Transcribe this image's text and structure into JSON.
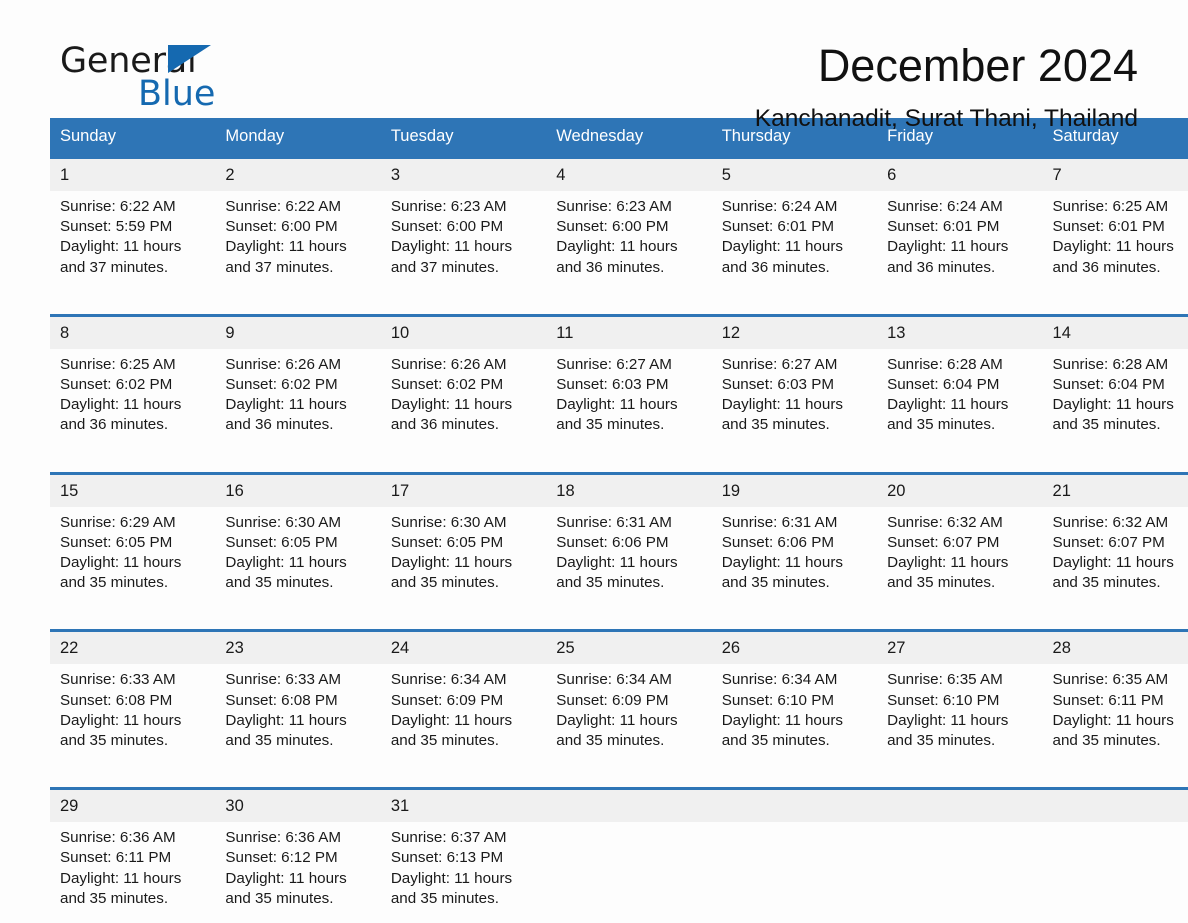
{
  "brand": {
    "name_line1": "General",
    "name_line2": "Blue",
    "accent_color": "#2e75b6",
    "logo_blue": "#1569b0"
  },
  "header": {
    "title": "December 2024",
    "subtitle": "Kanchanadit, Surat Thani, Thailand"
  },
  "calendar": {
    "weekday_headers": [
      "Sunday",
      "Monday",
      "Tuesday",
      "Wednesday",
      "Thursday",
      "Friday",
      "Saturday"
    ],
    "weeks": [
      [
        {
          "day": "1",
          "sunrise": "Sunrise: 6:22 AM",
          "sunset": "Sunset: 5:59 PM",
          "daylight1": "Daylight: 11 hours",
          "daylight2": "and 37 minutes."
        },
        {
          "day": "2",
          "sunrise": "Sunrise: 6:22 AM",
          "sunset": "Sunset: 6:00 PM",
          "daylight1": "Daylight: 11 hours",
          "daylight2": "and 37 minutes."
        },
        {
          "day": "3",
          "sunrise": "Sunrise: 6:23 AM",
          "sunset": "Sunset: 6:00 PM",
          "daylight1": "Daylight: 11 hours",
          "daylight2": "and 37 minutes."
        },
        {
          "day": "4",
          "sunrise": "Sunrise: 6:23 AM",
          "sunset": "Sunset: 6:00 PM",
          "daylight1": "Daylight: 11 hours",
          "daylight2": "and 36 minutes."
        },
        {
          "day": "5",
          "sunrise": "Sunrise: 6:24 AM",
          "sunset": "Sunset: 6:01 PM",
          "daylight1": "Daylight: 11 hours",
          "daylight2": "and 36 minutes."
        },
        {
          "day": "6",
          "sunrise": "Sunrise: 6:24 AM",
          "sunset": "Sunset: 6:01 PM",
          "daylight1": "Daylight: 11 hours",
          "daylight2": "and 36 minutes."
        },
        {
          "day": "7",
          "sunrise": "Sunrise: 6:25 AM",
          "sunset": "Sunset: 6:01 PM",
          "daylight1": "Daylight: 11 hours",
          "daylight2": "and 36 minutes."
        }
      ],
      [
        {
          "day": "8",
          "sunrise": "Sunrise: 6:25 AM",
          "sunset": "Sunset: 6:02 PM",
          "daylight1": "Daylight: 11 hours",
          "daylight2": "and 36 minutes."
        },
        {
          "day": "9",
          "sunrise": "Sunrise: 6:26 AM",
          "sunset": "Sunset: 6:02 PM",
          "daylight1": "Daylight: 11 hours",
          "daylight2": "and 36 minutes."
        },
        {
          "day": "10",
          "sunrise": "Sunrise: 6:26 AM",
          "sunset": "Sunset: 6:02 PM",
          "daylight1": "Daylight: 11 hours",
          "daylight2": "and 36 minutes."
        },
        {
          "day": "11",
          "sunrise": "Sunrise: 6:27 AM",
          "sunset": "Sunset: 6:03 PM",
          "daylight1": "Daylight: 11 hours",
          "daylight2": "and 35 minutes."
        },
        {
          "day": "12",
          "sunrise": "Sunrise: 6:27 AM",
          "sunset": "Sunset: 6:03 PM",
          "daylight1": "Daylight: 11 hours",
          "daylight2": "and 35 minutes."
        },
        {
          "day": "13",
          "sunrise": "Sunrise: 6:28 AM",
          "sunset": "Sunset: 6:04 PM",
          "daylight1": "Daylight: 11 hours",
          "daylight2": "and 35 minutes."
        },
        {
          "day": "14",
          "sunrise": "Sunrise: 6:28 AM",
          "sunset": "Sunset: 6:04 PM",
          "daylight1": "Daylight: 11 hours",
          "daylight2": "and 35 minutes."
        }
      ],
      [
        {
          "day": "15",
          "sunrise": "Sunrise: 6:29 AM",
          "sunset": "Sunset: 6:05 PM",
          "daylight1": "Daylight: 11 hours",
          "daylight2": "and 35 minutes."
        },
        {
          "day": "16",
          "sunrise": "Sunrise: 6:30 AM",
          "sunset": "Sunset: 6:05 PM",
          "daylight1": "Daylight: 11 hours",
          "daylight2": "and 35 minutes."
        },
        {
          "day": "17",
          "sunrise": "Sunrise: 6:30 AM",
          "sunset": "Sunset: 6:05 PM",
          "daylight1": "Daylight: 11 hours",
          "daylight2": "and 35 minutes."
        },
        {
          "day": "18",
          "sunrise": "Sunrise: 6:31 AM",
          "sunset": "Sunset: 6:06 PM",
          "daylight1": "Daylight: 11 hours",
          "daylight2": "and 35 minutes."
        },
        {
          "day": "19",
          "sunrise": "Sunrise: 6:31 AM",
          "sunset": "Sunset: 6:06 PM",
          "daylight1": "Daylight: 11 hours",
          "daylight2": "and 35 minutes."
        },
        {
          "day": "20",
          "sunrise": "Sunrise: 6:32 AM",
          "sunset": "Sunset: 6:07 PM",
          "daylight1": "Daylight: 11 hours",
          "daylight2": "and 35 minutes."
        },
        {
          "day": "21",
          "sunrise": "Sunrise: 6:32 AM",
          "sunset": "Sunset: 6:07 PM",
          "daylight1": "Daylight: 11 hours",
          "daylight2": "and 35 minutes."
        }
      ],
      [
        {
          "day": "22",
          "sunrise": "Sunrise: 6:33 AM",
          "sunset": "Sunset: 6:08 PM",
          "daylight1": "Daylight: 11 hours",
          "daylight2": "and 35 minutes."
        },
        {
          "day": "23",
          "sunrise": "Sunrise: 6:33 AM",
          "sunset": "Sunset: 6:08 PM",
          "daylight1": "Daylight: 11 hours",
          "daylight2": "and 35 minutes."
        },
        {
          "day": "24",
          "sunrise": "Sunrise: 6:34 AM",
          "sunset": "Sunset: 6:09 PM",
          "daylight1": "Daylight: 11 hours",
          "daylight2": "and 35 minutes."
        },
        {
          "day": "25",
          "sunrise": "Sunrise: 6:34 AM",
          "sunset": "Sunset: 6:09 PM",
          "daylight1": "Daylight: 11 hours",
          "daylight2": "and 35 minutes."
        },
        {
          "day": "26",
          "sunrise": "Sunrise: 6:34 AM",
          "sunset": "Sunset: 6:10 PM",
          "daylight1": "Daylight: 11 hours",
          "daylight2": "and 35 minutes."
        },
        {
          "day": "27",
          "sunrise": "Sunrise: 6:35 AM",
          "sunset": "Sunset: 6:10 PM",
          "daylight1": "Daylight: 11 hours",
          "daylight2": "and 35 minutes."
        },
        {
          "day": "28",
          "sunrise": "Sunrise: 6:35 AM",
          "sunset": "Sunset: 6:11 PM",
          "daylight1": "Daylight: 11 hours",
          "daylight2": "and 35 minutes."
        }
      ],
      [
        {
          "day": "29",
          "sunrise": "Sunrise: 6:36 AM",
          "sunset": "Sunset: 6:11 PM",
          "daylight1": "Daylight: 11 hours",
          "daylight2": "and 35 minutes."
        },
        {
          "day": "30",
          "sunrise": "Sunrise: 6:36 AM",
          "sunset": "Sunset: 6:12 PM",
          "daylight1": "Daylight: 11 hours",
          "daylight2": "and 35 minutes."
        },
        {
          "day": "31",
          "sunrise": "Sunrise: 6:37 AM",
          "sunset": "Sunset: 6:13 PM",
          "daylight1": "Daylight: 11 hours",
          "daylight2": "and 35 minutes."
        },
        {
          "day": "",
          "sunrise": "",
          "sunset": "",
          "daylight1": "",
          "daylight2": ""
        },
        {
          "day": "",
          "sunrise": "",
          "sunset": "",
          "daylight1": "",
          "daylight2": ""
        },
        {
          "day": "",
          "sunrise": "",
          "sunset": "",
          "daylight1": "",
          "daylight2": ""
        },
        {
          "day": "",
          "sunrise": "",
          "sunset": "",
          "daylight1": "",
          "daylight2": ""
        }
      ]
    ]
  }
}
